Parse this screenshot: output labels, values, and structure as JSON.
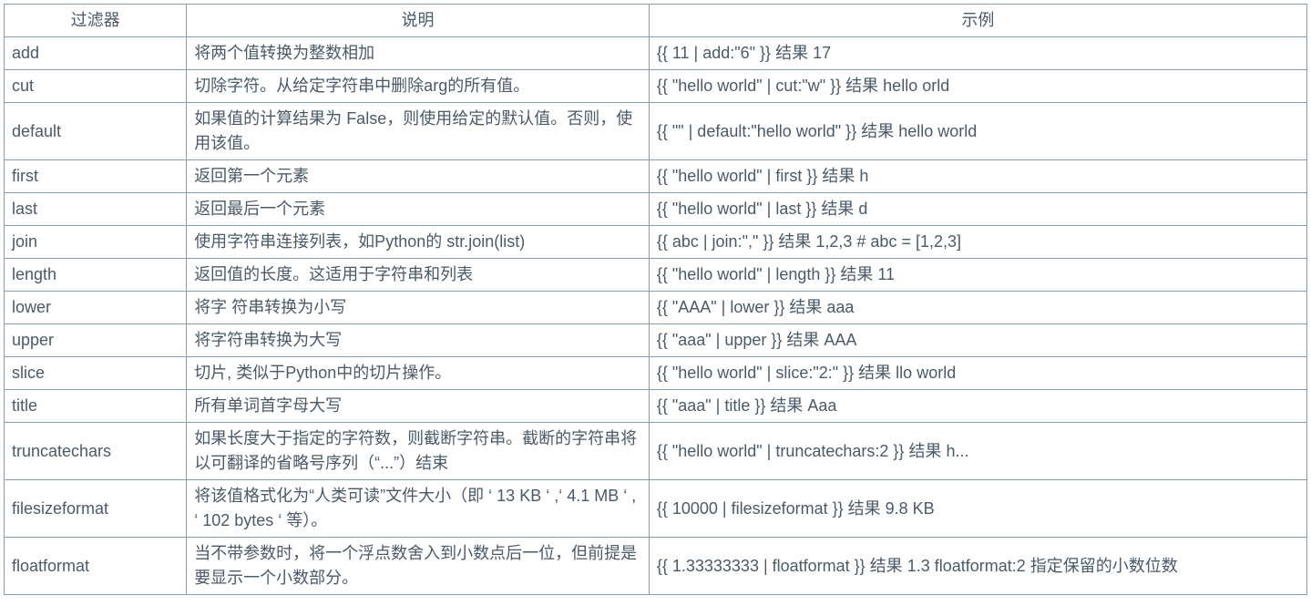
{
  "table": {
    "headers": [
      "过滤器",
      "说明",
      "示例"
    ],
    "rows": [
      {
        "filter": "add",
        "desc": "将两个值转换为整数相加",
        "example": "{{ 11 | add:\"6\" }} 结果 17"
      },
      {
        "filter": "cut",
        "desc": "切除字符。从给定字符串中删除arg的所有值。",
        "example": "{{ \"hello world\" | cut:\"w\" }} 结果 hello orld"
      },
      {
        "filter": "default",
        "desc": "如果值的计算结果为 False，则使用给定的默认值。否则，使用该值。",
        "example": "{{ \"\" | default:\"hello world\" }} 结果 hello world"
      },
      {
        "filter": "first",
        "desc": "返回第一个元素",
        "example": "{{ \"hello world\" | first }} 结果 h"
      },
      {
        "filter": "last",
        "desc": "返回最后一个元素",
        "example": "{{ \"hello world\" | last }} 结果 d"
      },
      {
        "filter": "join",
        "desc": "使用字符串连接列表，如Python的 str.join(list)",
        "example": "{{ abc | join:\",\" }} 结果 1,2,3  # abc = [1,2,3]"
      },
      {
        "filter": "length",
        "desc": "返回值的长度。这适用于字符串和列表",
        "example": "{{ \"hello world\" | length }} 结果 11"
      },
      {
        "filter": "lower",
        "desc": "将字 符串转换为小写",
        "example": "{{ \"AAA\" | lower }} 结果 aaa"
      },
      {
        "filter": "upper",
        "desc": "将字符串转换为大写",
        "example": "{{ \"aaa\" | upper }} 结果 AAA"
      },
      {
        "filter": "slice",
        "desc": "切片, 类似于Python中的切片操作。",
        "example": "{{ \"hello world\" | slice:\"2:\" }} 结果 llo world"
      },
      {
        "filter": "title",
        "desc": "所有单词首字母大写",
        "example": "{{ \"aaa\" | title }} 结果 Aaa"
      },
      {
        "filter": "truncatechars",
        "desc": "如果长度大于指定的字符数，则截断字符串。截断的字符串将以可翻译的省略号序列（“...”）结束",
        "example": "{{ \"hello world\" | truncatechars:2 }} 结果 h..."
      },
      {
        "filter": "filesizeformat",
        "desc": "将该值格式化为“人类可读”文件大小（即 ‘ 13 KB ‘ ,‘ 4.1 MB ‘ , ‘ 102 bytes ‘ 等）。",
        "example": "{{ 10000 | filesizeformat }} 结果 9.8 KB"
      },
      {
        "filter": "floatformat",
        "desc": "当不带参数时，将一个浮点数舍入到小数点后一位，但前提是要显示一个小数部分。",
        "example": "{{ 1.33333333 | floatformat }} 结果 1.3 floatformat:2 指定保留的小数位数"
      }
    ]
  }
}
